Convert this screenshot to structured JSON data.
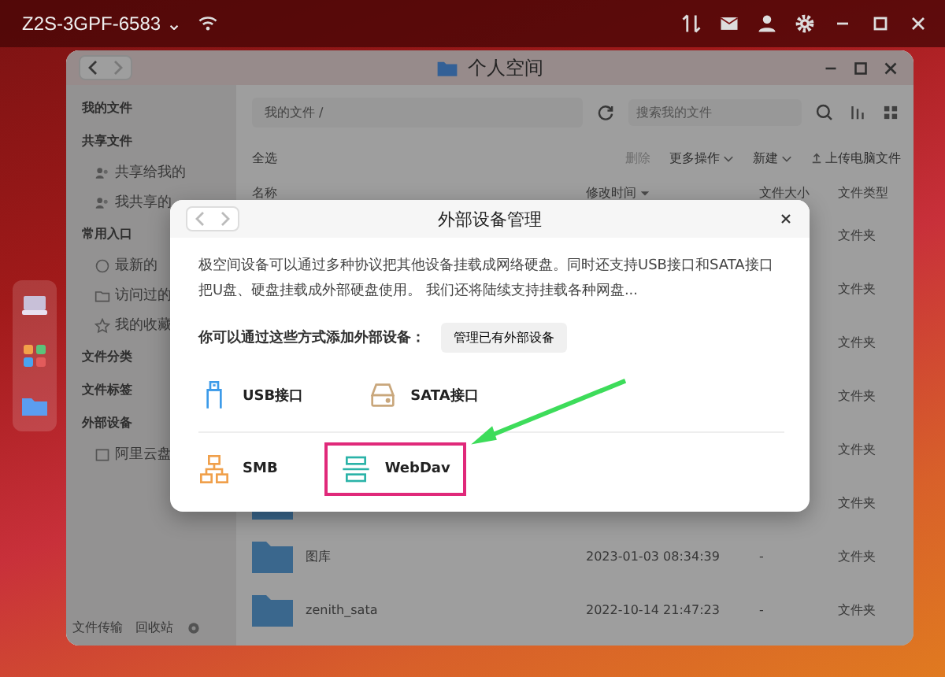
{
  "top_bar": {
    "device": "Z2S-3GPF-6583",
    "caret": "⌄"
  },
  "window": {
    "title": "个人空间"
  },
  "sidebar": {
    "items": [
      {
        "label": "我的文件"
      },
      {
        "label": "共享文件",
        "children": [
          {
            "label": "共享给我的",
            "kind": "share"
          },
          {
            "label": "我共享的",
            "kind": "share"
          }
        ]
      },
      {
        "label": "常用入口",
        "children": [
          {
            "label": "最新的",
            "kind": "clock"
          },
          {
            "label": "访问过的",
            "kind": "folder"
          },
          {
            "label": "我的收藏",
            "kind": "star"
          }
        ]
      },
      {
        "label": "文件分类"
      },
      {
        "label": "文件标签"
      },
      {
        "label": "外部设备",
        "children": [
          {
            "label": "阿里云盘",
            "kind": "disk"
          }
        ]
      }
    ],
    "footer": [
      "文件传输",
      "回收站"
    ]
  },
  "toolbar": {
    "path": "我的文件 /",
    "search_placeholder": "搜索我的文件",
    "select_all": "全选",
    "delete": "删除",
    "more": "更多操作",
    "new": "新建",
    "upload": "上传电脑文件"
  },
  "table": {
    "columns": [
      "名称",
      "修改时间",
      "文件大小",
      "文件类型"
    ],
    "rows": [
      {
        "type": "文件夹"
      },
      {
        "type": "文件夹"
      },
      {
        "type": "文件夹"
      },
      {
        "type": "文件夹"
      },
      {
        "type": "文件夹"
      },
      {
        "type": "文件夹"
      },
      {
        "name": "图库",
        "modified": "2023-01-03 08:34:39",
        "size": "-",
        "type": "文件夹"
      },
      {
        "name": "zenith_sata",
        "modified": "2022-10-14 21:47:23",
        "size": "-",
        "type": "文件夹"
      }
    ]
  },
  "dialog": {
    "title": "外部设备管理",
    "description": "极空间设备可以通过多种协议把其他设备挂载成网络硬盘。同时还支持USB接口和SATA接口把U盘、硬盘挂载成外部硬盘使用。 我们还将陆续支持挂载各种网盘...",
    "prompt": "你可以通过这些方式添加外部设备：",
    "manage_button": "管理已有外部设备",
    "groups": [
      [
        {
          "label": "USB接口",
          "kind": "usb",
          "highlighted": false
        },
        {
          "label": "SATA接口",
          "kind": "sata",
          "highlighted": false
        }
      ],
      [
        {
          "label": "SMB",
          "kind": "smb",
          "highlighted": false
        },
        {
          "label": "WebDav",
          "kind": "webdav",
          "highlighted": true
        }
      ]
    ]
  }
}
